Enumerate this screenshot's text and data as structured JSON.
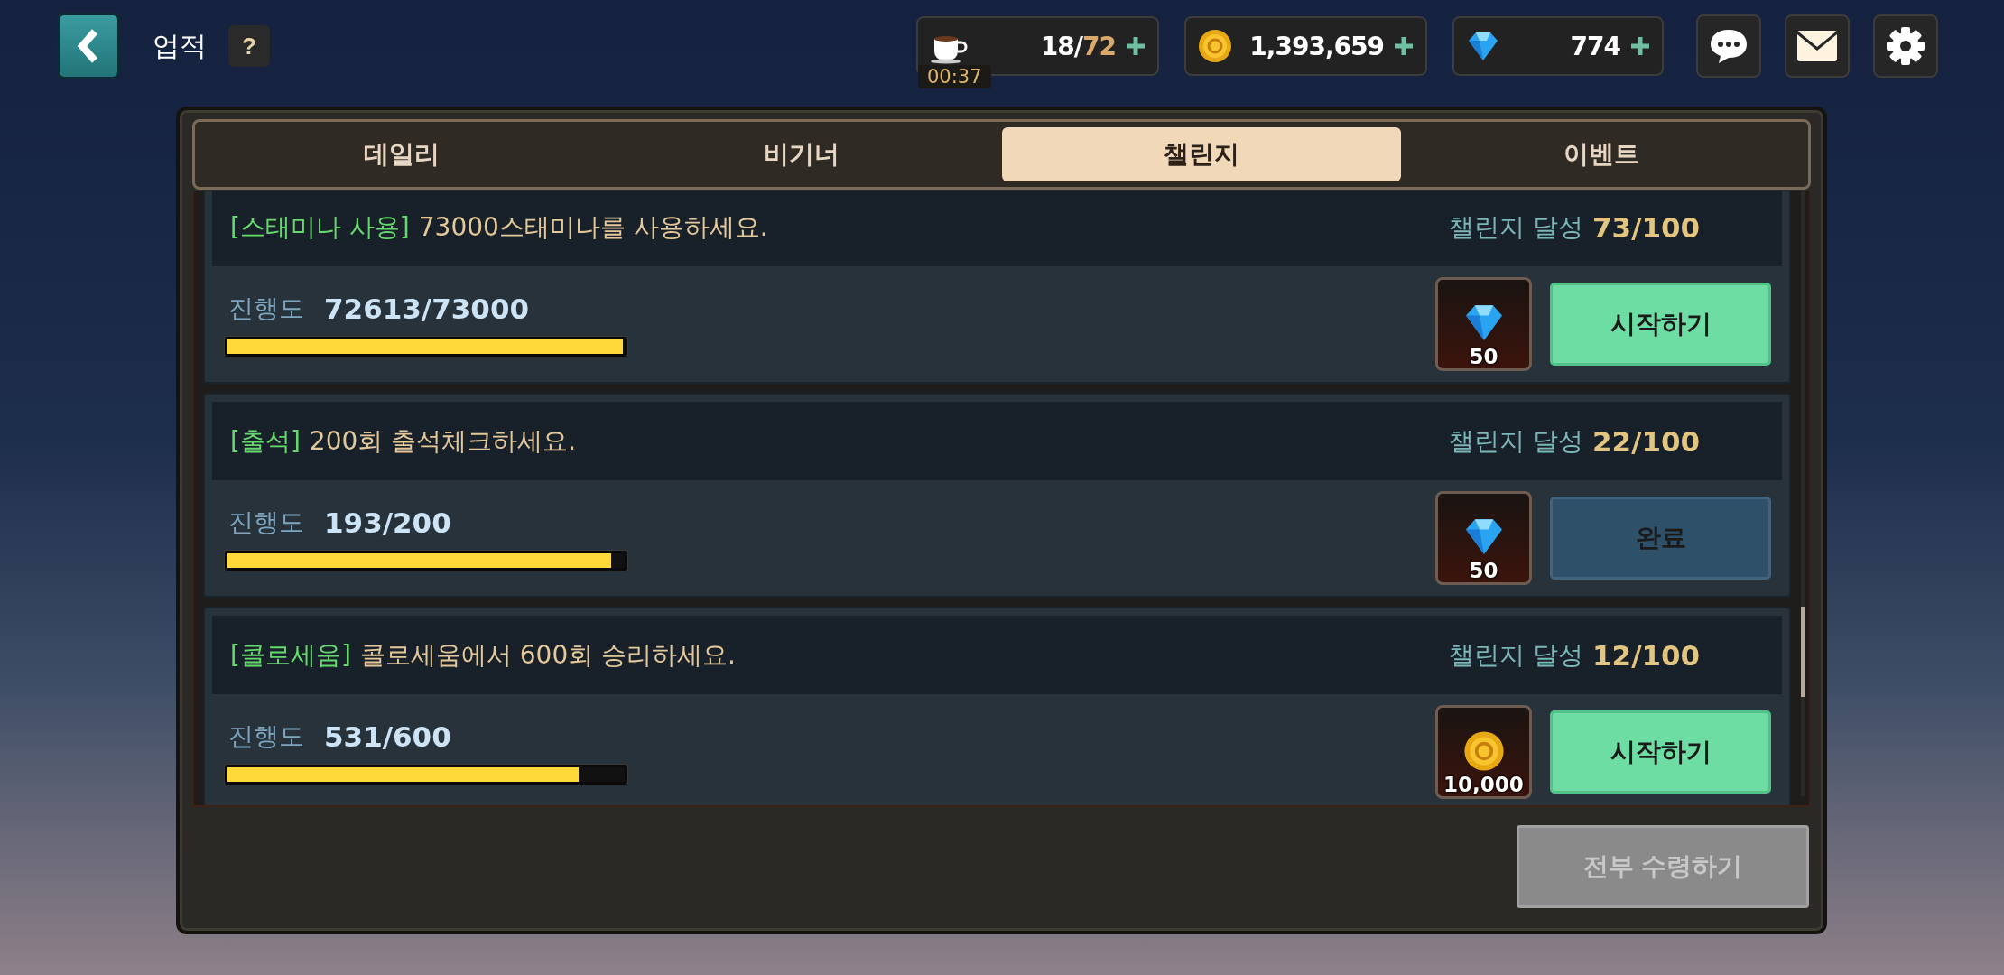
{
  "header": {
    "title": "업적",
    "help": "?"
  },
  "resources": [
    {
      "kind": "stamina",
      "value": "18/",
      "max": "72",
      "timer": "00:37"
    },
    {
      "kind": "gold",
      "value": "1,393,659"
    },
    {
      "kind": "gem",
      "value": "774"
    }
  ],
  "tabs": [
    {
      "label": "데일리",
      "selected": false
    },
    {
      "label": "비기너",
      "selected": false
    },
    {
      "label": "챌린지",
      "selected": true
    },
    {
      "label": "이벤트",
      "selected": false
    }
  ],
  "quests": [
    {
      "tag": "[스태미나 사용]",
      "text": "73000스태미나를 사용하세요.",
      "achieve_label": "챌린지 달성",
      "achieve": "73/100",
      "progress_label": "진행도",
      "progress": "72613/73000",
      "level": 0.995,
      "reward": {
        "kind": "gem",
        "amount": "50"
      },
      "button": {
        "label": "시작하기",
        "kind": "start"
      }
    },
    {
      "tag": "[출석]",
      "text": "200회 출석체크하세요.",
      "achieve_label": "챌린지 달성",
      "achieve": "22/100",
      "progress_label": "진행도",
      "progress": "193/200",
      "level": 0.965,
      "reward": {
        "kind": "gem",
        "amount": "50"
      },
      "button": {
        "label": "완료",
        "kind": "done"
      }
    },
    {
      "tag": "[콜로세움]",
      "text": "콜로세움에서 600회 승리하세요.",
      "achieve_label": "챌린지 달성",
      "achieve": "12/100",
      "progress_label": "진행도",
      "progress": "531/600",
      "level": 0.885,
      "reward": {
        "kind": "gold",
        "amount": "10,000"
      },
      "button": {
        "label": "시작하기",
        "kind": "start"
      }
    }
  ],
  "claim_all": {
    "label": "전부 수령하기",
    "disabled": true
  }
}
